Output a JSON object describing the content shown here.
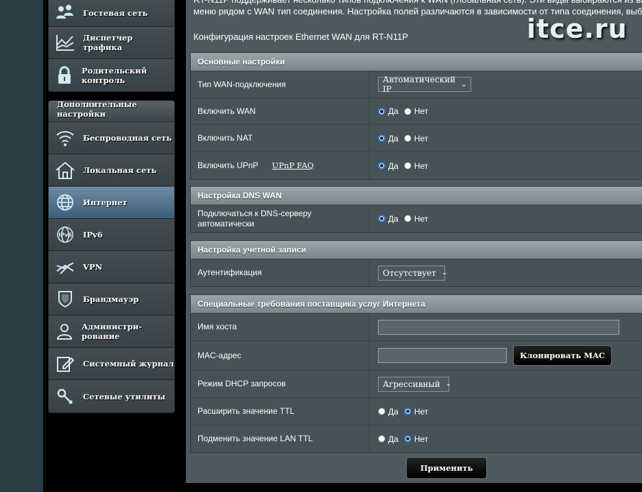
{
  "watermark": "itce.ru",
  "sidebar": {
    "group1": [
      {
        "label": "Гостевая сеть",
        "icon": "guest-network-icon"
      },
      {
        "label": "Диспетчер трафика",
        "icon": "traffic-manager-icon"
      },
      {
        "label": "Родительский контроль",
        "icon": "lock-icon"
      }
    ],
    "advanced_header": "Дополнительные настройки",
    "group2": [
      {
        "label": "Беспроводная сеть",
        "icon": "wifi-icon"
      },
      {
        "label": "Локальная сеть",
        "icon": "home-icon"
      },
      {
        "label": "Интернет",
        "icon": "globe-icon",
        "active": true
      },
      {
        "label": "IPv6",
        "icon": "ipv6-globe-icon"
      },
      {
        "label": "VPN",
        "icon": "vpn-icon"
      },
      {
        "label": "Брандмауэр",
        "icon": "shield-icon"
      },
      {
        "label": "Администри- рование",
        "icon": "admin-user-icon"
      },
      {
        "label": "Системный журнал",
        "icon": "log-edit-icon"
      },
      {
        "label": "Сетевые утилиты",
        "icon": "tools-icon"
      }
    ]
  },
  "content": {
    "desc_line1": "RT-N11P поддерживает несколько типов подключения к WAN (глобальная сеть). Эти виды выбираются из выпадающего",
    "desc_line2": "меню рядом с WAN тип соединения. Настройка полей различаются в зависимости от типа соединения, выбранного.",
    "config_line": "Конфигурация настроек Ethernet WAN для RT-N11P",
    "yes": "Да",
    "no": "Нет",
    "basic": {
      "title": "Основные настройки",
      "wan_type_label": "Тип WAN-подключения",
      "wan_type_value": "Автоматический IP",
      "enable_wan_label": "Включить WAN",
      "enable_nat_label": "Включить NAT",
      "enable_upnp_label": "Включить UPnP",
      "upnp_faq": "UPnP FAQ"
    },
    "dns": {
      "title": "Настройка DNS WAN",
      "auto_dns_label": "Подключаться к DNS-серверу автоматически"
    },
    "account": {
      "title": "Настройка учетной записи",
      "auth_label": "Аутентификация",
      "auth_value": "Отсутствует"
    },
    "isp": {
      "title": "Специальные требования поставщика услуг Интернета",
      "host_label": "Имя хоста",
      "host_value": "",
      "mac_label": "MAC-адрес",
      "mac_value": "",
      "clone_mac": "Клонировать MAC",
      "dhcp_label": "Режим DHCP запросов",
      "dhcp_value": "Агрессивный",
      "ttl_label": "Расширить значение TTL",
      "lan_ttl_label": "Подменить значение LAN TTL"
    },
    "apply": "Применить"
  }
}
